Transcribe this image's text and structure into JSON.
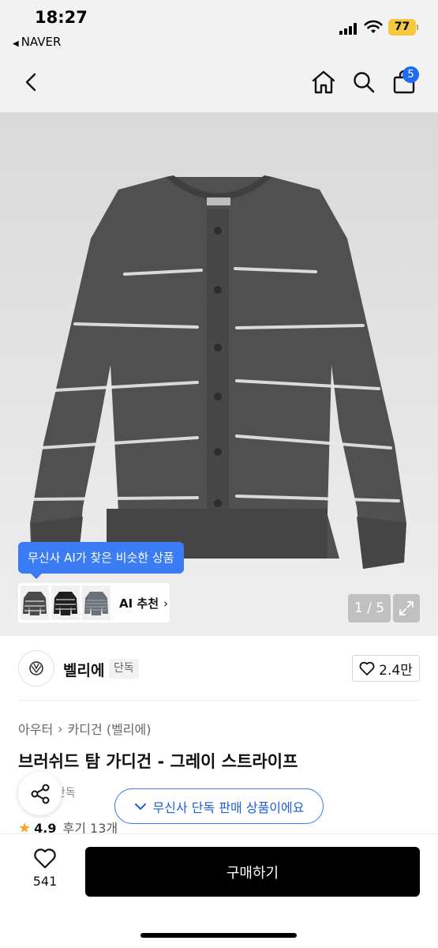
{
  "status_bar": {
    "time": "18:27",
    "back_app": "NAVER",
    "battery": "77"
  },
  "nav": {
    "cart_count": "5"
  },
  "gallery": {
    "ai_tooltip": "무신사 AI가 찾은 비슷한 상품",
    "ai_recommend": "AI 추천",
    "counter": "1 / 5"
  },
  "brand": {
    "name": "벨리에",
    "badge": "단독",
    "likes": "2.4만"
  },
  "breadcrumb": {
    "level1": "아우터",
    "level2": "카디건 (벨리에)"
  },
  "product": {
    "title": "브러쉬드 탐 가디건 - 그레이 스트라이프",
    "tag": "단독",
    "exclusive_notice": "무신사 단독 판매 상품이에요",
    "rating": "4.9",
    "reviews": "후기 13개"
  },
  "bottom_bar": {
    "wish_count": "541",
    "buy_label": "구매하기"
  },
  "colors": {
    "accent": "#3b7cf5",
    "badge_blue": "#1e6cf3",
    "battery": "#f4c93d",
    "star": "#f5a623",
    "sweater": "#4e4e4e"
  }
}
